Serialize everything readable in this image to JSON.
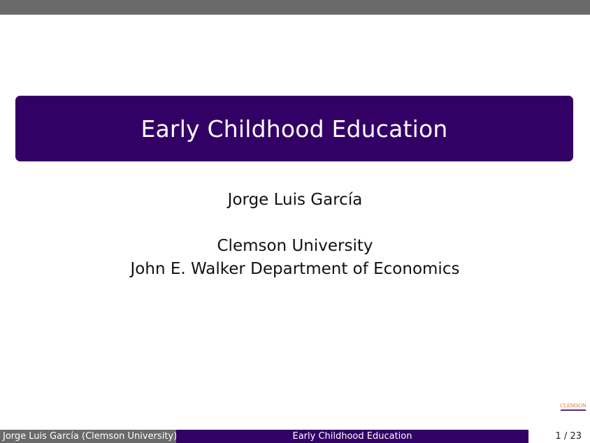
{
  "slide": {
    "title": "Early Childhood Education",
    "author": "Jorge Luis García",
    "institute_line1": "Clemson University",
    "institute_line2": "John E. Walker Department of Economics"
  },
  "logo": {
    "text": "CLEMSON",
    "icon": "clemson-logo-icon"
  },
  "footer": {
    "left": "Jorge Luis García (Clemson University)",
    "center": "Early Childhood Education",
    "page": "1 / 23"
  },
  "colors": {
    "accent": "#330066",
    "header_gray": "#6a6a6a",
    "logo_orange": "#ef6b15"
  }
}
